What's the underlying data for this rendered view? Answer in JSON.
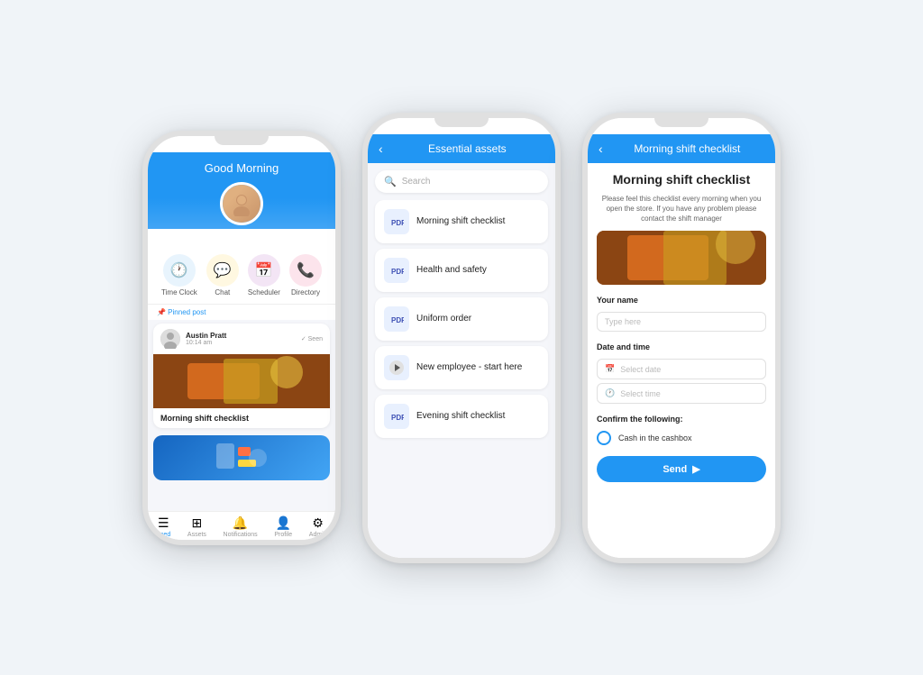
{
  "phone1": {
    "header_title": "Good Morning",
    "nav_icons": [
      {
        "label": "Time Clock",
        "icon": "🕐",
        "style": "icon-blue"
      },
      {
        "label": "Chat",
        "icon": "🗂",
        "style": "icon-yellow"
      },
      {
        "label": "Scheduler",
        "icon": "📅",
        "style": "icon-purple"
      },
      {
        "label": "Directory",
        "icon": "📞",
        "style": "icon-pink"
      }
    ],
    "pinned_label": "📌 Pinned post",
    "post_author": "Austin Pratt",
    "post_time": "10:14 am",
    "post_seen": "✓ Seen",
    "post_caption": "Morning shift checklist",
    "bottom_nav": [
      {
        "label": "Feed",
        "active": true,
        "icon": "☰"
      },
      {
        "label": "Assets",
        "active": false,
        "icon": "⊞"
      },
      {
        "label": "Notifications",
        "active": false,
        "icon": "🔔"
      },
      {
        "label": "Profile",
        "active": false,
        "icon": "👤"
      },
      {
        "label": "Admin",
        "active": false,
        "icon": "⚙"
      }
    ]
  },
  "phone2": {
    "header_title": "Essential assets",
    "search_placeholder": "Search",
    "assets": [
      {
        "label": "Morning shift checklist",
        "type": "pdf"
      },
      {
        "label": "Health and safety",
        "type": "pdf"
      },
      {
        "label": "Uniform order",
        "type": "pdf"
      },
      {
        "label": "New employee - start here",
        "type": "play"
      },
      {
        "label": "Evening shift checklist",
        "type": "pdf"
      }
    ]
  },
  "phone3": {
    "header_title": "Morning shift checklist",
    "checklist_title": "Morning shift checklist",
    "checklist_desc": "Please feel this checklist every morning when you open the store. If you have any problem please contact the shift manager",
    "your_name_label": "Your name",
    "your_name_placeholder": "Type here",
    "date_time_label": "Date and time",
    "select_date_placeholder": "Select date",
    "select_time_placeholder": "Select time",
    "confirm_label": "Confirm the following:",
    "confirm_item": "Cash in the cashbox",
    "send_label": "Send"
  }
}
